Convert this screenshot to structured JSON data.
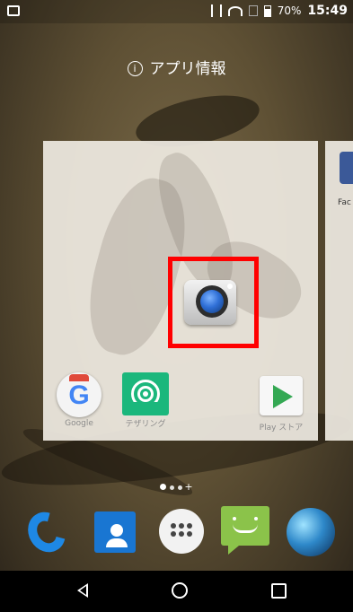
{
  "status_bar": {
    "icons": [
      "gallery-icon",
      "vibrate-icon",
      "wifi-icon",
      "no-sim-icon",
      "battery-icon"
    ],
    "battery": "70%",
    "time": "15:49"
  },
  "header": {
    "label": "アプリ情報",
    "icon": "info-icon"
  },
  "page_preview": {
    "apps": [
      {
        "name": "Google",
        "icon": "google-icon"
      },
      {
        "name": "テザリング",
        "icon": "tethering-icon"
      },
      {
        "name": "Play ストア",
        "icon": "play-store-icon"
      }
    ],
    "dragged_app_icon": "camera-icon",
    "highlight_color": "#ff0000",
    "next_page_label": "Fac"
  },
  "page_indicator": {
    "plus": "+"
  },
  "dock": {
    "apps": [
      "phone-icon",
      "contacts-icon",
      "app-drawer-icon",
      "messaging-icon",
      "browser-icon"
    ]
  },
  "nav": {
    "buttons": [
      "back-icon",
      "home-icon",
      "recents-icon"
    ]
  }
}
